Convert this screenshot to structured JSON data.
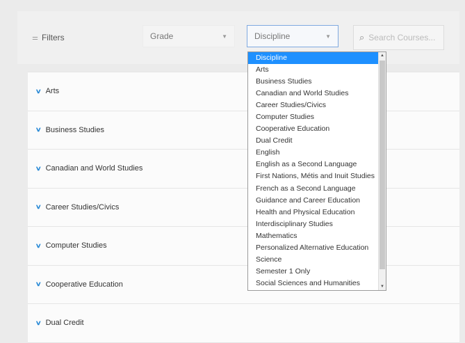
{
  "filter_bar": {
    "filters_label": "Filters",
    "filters_icon": "sliders-icon",
    "grade_select": {
      "value": "Grade"
    },
    "discipline_select": {
      "value": "Discipline"
    },
    "search": {
      "placeholder": "Search Courses..."
    }
  },
  "dropdown": {
    "selected": "Discipline",
    "options": [
      "Discipline",
      "Arts",
      "Business Studies",
      "Canadian and World Studies",
      "Career Studies/Civics",
      "Computer Studies",
      "Cooperative Education",
      "Dual Credit",
      "English",
      "English as a Second Language",
      "First Nations, Métis and Inuit Studies",
      "French as a Second Language",
      "Guidance and Career Education",
      "Health and Physical Education",
      "Interdisciplinary Studies",
      "Mathematics",
      "Personalized Alternative Education",
      "Science",
      "Semester 1 Only",
      "Social Sciences and Humanities"
    ]
  },
  "course_list": [
    {
      "label": "Arts"
    },
    {
      "label": "Business Studies"
    },
    {
      "label": "Canadian and World Studies"
    },
    {
      "label": "Career Studies/Civics"
    },
    {
      "label": "Computer Studies"
    },
    {
      "label": "Cooperative Education"
    },
    {
      "label": "Dual Credit"
    }
  ],
  "colors": {
    "accent": "#2a8ad6",
    "selected_option": "#1e90ff"
  }
}
